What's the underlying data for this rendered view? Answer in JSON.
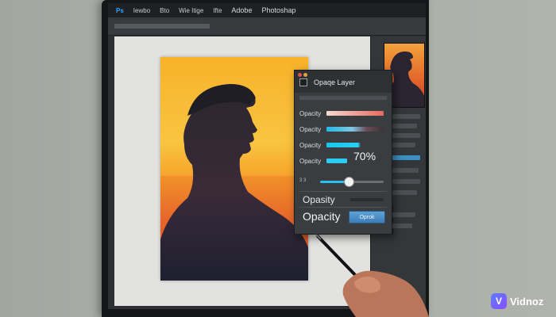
{
  "app": {
    "menu": [
      "Ps",
      "Iewbo",
      "Bto",
      "Wie Itige",
      "Ifte",
      "Adobe",
      "Photoshap"
    ]
  },
  "dialog": {
    "title": "Opaqe Layer",
    "rows": [
      "Opacity",
      "Opacity",
      "Opacity",
      "Opacity"
    ],
    "percent": "70%",
    "slider_label": "3 3",
    "slider_value_fraction": 0.45,
    "opasity_label": "Opasity",
    "opacity_label": "Opacity",
    "ok_button_label": "Oprok"
  },
  "watermark": {
    "mark": "V",
    "text": "Vidnoz"
  },
  "colors": {
    "accent_cyan": "#28c2f0",
    "ok_button": "#4a8cc6",
    "sunset_top": "#f9c441",
    "sunset_bottom": "#c9452b"
  }
}
